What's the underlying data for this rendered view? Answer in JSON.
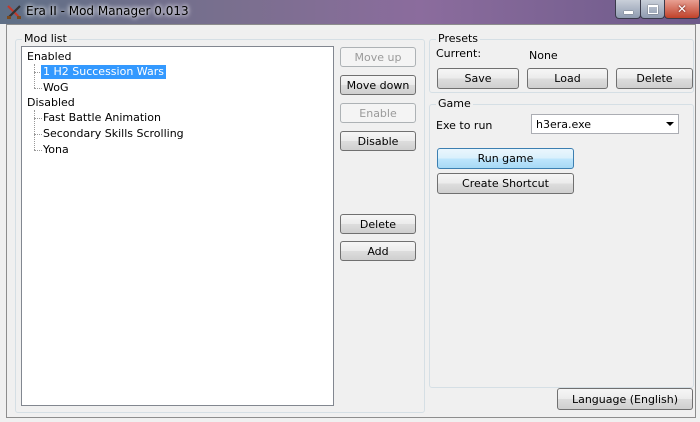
{
  "window": {
    "title": "Era II - Mod Manager 0.013"
  },
  "mod_list": {
    "label": "Mod list",
    "enabled_label": "Enabled",
    "enabled_items": [
      "1 H2 Succession Wars",
      "WoG"
    ],
    "disabled_label": "Disabled",
    "disabled_items": [
      "Fast Battle Animation",
      "Secondary Skills Scrolling",
      "Yona"
    ]
  },
  "mod_buttons": {
    "move_up": "Move up",
    "move_down": "Move down",
    "enable": "Enable",
    "disable": "Disable",
    "delete": "Delete",
    "add": "Add"
  },
  "presets": {
    "label": "Presets",
    "current_label": "Current:",
    "current_value": "None",
    "save": "Save",
    "load": "Load",
    "delete": "Delete"
  },
  "game": {
    "label": "Game",
    "exe_label": "Exe to run",
    "exe_value": "h3era.exe",
    "run_game": "Run game",
    "create_shortcut": "Create Shortcut"
  },
  "language_button": "Language (English)"
}
